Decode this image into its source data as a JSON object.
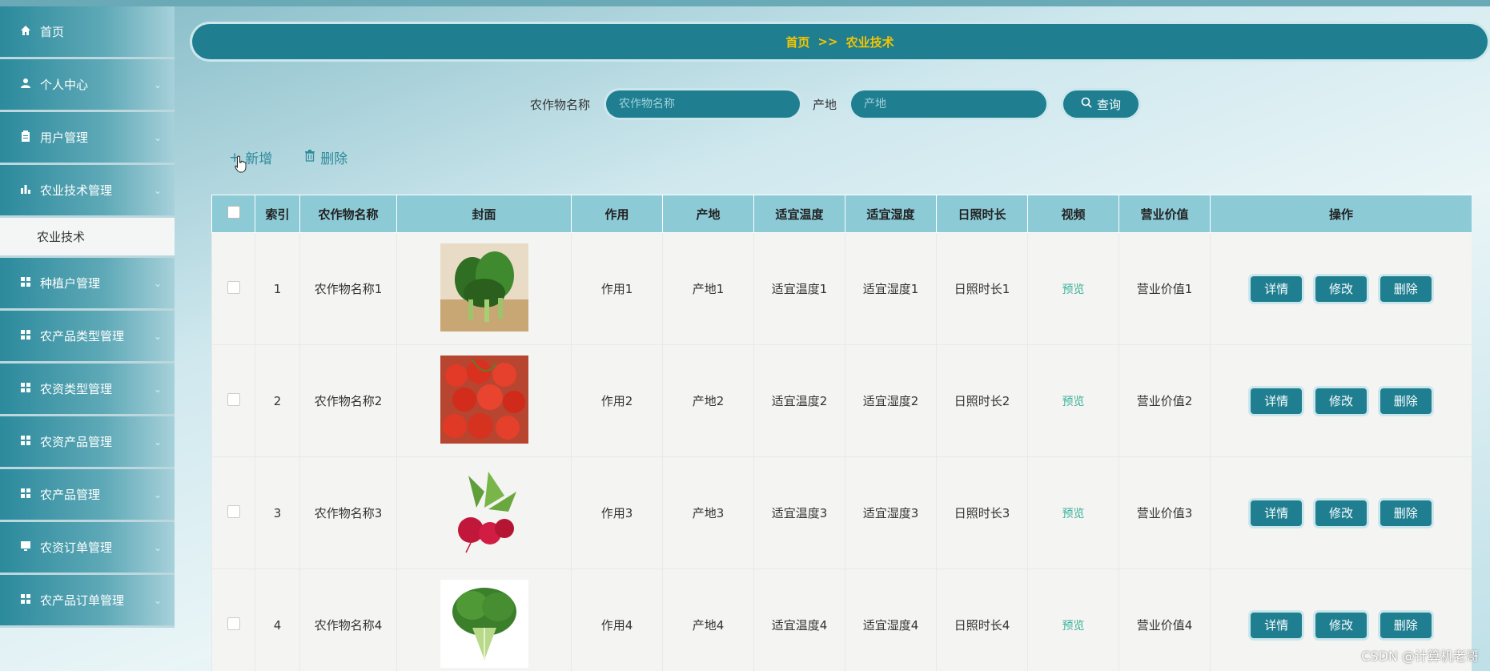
{
  "sidebar": {
    "items": [
      {
        "label": "首页",
        "icon": "home-icon",
        "chevron": false
      },
      {
        "label": "个人中心",
        "icon": "user-icon",
        "chevron": true
      },
      {
        "label": "用户管理",
        "icon": "clipboard-icon",
        "chevron": true
      },
      {
        "label": "农业技术管理",
        "icon": "bar-chart-icon",
        "chevron": true
      },
      {
        "label": "种植户管理",
        "icon": "grid-icon",
        "chevron": true
      },
      {
        "label": "农产品类型管理",
        "icon": "grid-icon",
        "chevron": true
      },
      {
        "label": "农资类型管理",
        "icon": "grid-icon",
        "chevron": true
      },
      {
        "label": "农资产品管理",
        "icon": "grid-icon",
        "chevron": true
      },
      {
        "label": "农产品管理",
        "icon": "grid-icon",
        "chevron": true
      },
      {
        "label": "农资订单管理",
        "icon": "monitor-icon",
        "chevron": true
      },
      {
        "label": "农产品订单管理",
        "icon": "grid-icon",
        "chevron": true
      }
    ],
    "sub_item": "农业技术"
  },
  "breadcrumb": {
    "home": "首页",
    "separator": ">>",
    "current": "农业技术"
  },
  "search": {
    "name_label": "农作物名称",
    "name_placeholder": "农作物名称",
    "origin_label": "产地",
    "origin_placeholder": "产地",
    "query_button": "查询"
  },
  "actions": {
    "add": "新增",
    "delete": "删除"
  },
  "table": {
    "headers": [
      "索引",
      "农作物名称",
      "封面",
      "作用",
      "产地",
      "适宜温度",
      "适宜湿度",
      "日照时长",
      "视频",
      "营业价值",
      "操作"
    ],
    "rows": [
      {
        "index": "1",
        "name": "农作物名称1",
        "cover": "green-vegetable",
        "effect": "作用1",
        "origin": "产地1",
        "temp": "适宜温度1",
        "humidity": "适宜湿度1",
        "sunlight": "日照时长1",
        "video": "预览",
        "value": "营业价值1"
      },
      {
        "index": "2",
        "name": "农作物名称2",
        "cover": "cherry-tomatoes",
        "effect": "作用2",
        "origin": "产地2",
        "temp": "适宜温度2",
        "humidity": "适宜湿度2",
        "sunlight": "日照时长2",
        "video": "预览",
        "value": "营业价值2"
      },
      {
        "index": "3",
        "name": "农作物名称3",
        "cover": "radish",
        "effect": "作用3",
        "origin": "产地3",
        "temp": "适宜温度3",
        "humidity": "适宜湿度3",
        "sunlight": "日照时长3",
        "video": "预览",
        "value": "营业价值3"
      },
      {
        "index": "4",
        "name": "农作物名称4",
        "cover": "lettuce",
        "effect": "作用4",
        "origin": "产地4",
        "temp": "适宜温度4",
        "humidity": "适宜湿度4",
        "sunlight": "日照时长4",
        "video": "预览",
        "value": "营业价值4"
      }
    ],
    "row_buttons": {
      "detail": "详情",
      "edit": "修改",
      "delete": "删除"
    }
  },
  "watermark": "CSDN @计算机老哥",
  "colors": {
    "primary": "#1f7f91",
    "header_bg": "#8ccad6",
    "breadcrumb_text": "#f5c400",
    "preview": "#3ab09a"
  }
}
